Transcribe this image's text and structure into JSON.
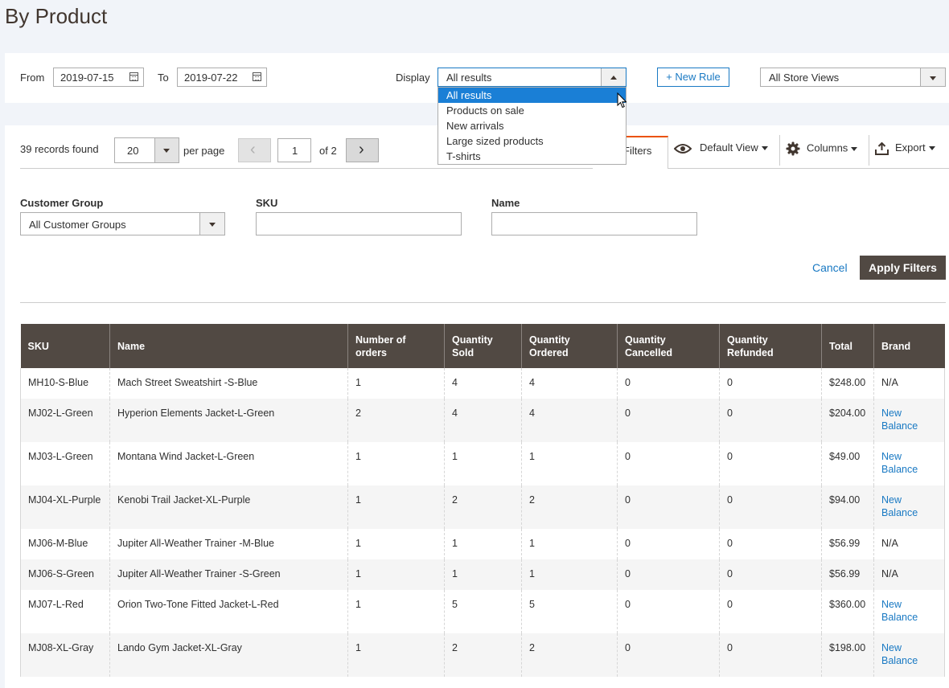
{
  "page": {
    "title": "By Product"
  },
  "topbar": {
    "from_label": "From",
    "from_value": "2019-07-15",
    "to_label": "To",
    "to_value": "2019-07-22",
    "display_label": "Display",
    "display_value": "All results",
    "display_options": [
      "All results",
      "Products on sale",
      "New arrivals",
      "Large sized products",
      "T-shirts"
    ],
    "new_rule_label": "+ New Rule",
    "store_view_value": "All Store Views"
  },
  "grid_toolbar": {
    "records_text": "39 records found",
    "per_page_value": "20",
    "per_page_label": "per page",
    "page_value": "1",
    "page_of": "of 2",
    "filters_tab": "Filters",
    "default_view": "Default View",
    "columns": "Columns",
    "export": "Export"
  },
  "filters": {
    "customer_group_label": "Customer Group",
    "customer_group_value": "All Customer Groups",
    "sku_label": "SKU",
    "name_label": "Name",
    "cancel_label": "Cancel",
    "apply_label": "Apply Filters"
  },
  "table": {
    "headers": [
      "SKU",
      "Name",
      "Number of orders",
      "Quantity Sold",
      "Quantity Ordered",
      "Quantity Cancelled",
      "Quantity Refunded",
      "Total",
      "Brand"
    ],
    "rows": [
      {
        "sku": "MH10-S-Blue",
        "name": "Mach Street Sweatshirt -S-Blue",
        "orders": "1",
        "sold": "4",
        "ordered": "4",
        "cancelled": "0",
        "refunded": "0",
        "total": "$248.00",
        "brand": "N/A"
      },
      {
        "sku": "MJ02-L-Green",
        "name": "Hyperion Elements Jacket-L-Green",
        "orders": "2",
        "sold": "4",
        "ordered": "4",
        "cancelled": "0",
        "refunded": "0",
        "total": "$204.00",
        "brand": "New Balance"
      },
      {
        "sku": "MJ03-L-Green",
        "name": "Montana Wind Jacket-L-Green",
        "orders": "1",
        "sold": "1",
        "ordered": "1",
        "cancelled": "0",
        "refunded": "0",
        "total": "$49.00",
        "brand": "New Balance"
      },
      {
        "sku": "MJ04-XL-Purple",
        "name": "Kenobi Trail Jacket-XL-Purple",
        "orders": "1",
        "sold": "2",
        "ordered": "2",
        "cancelled": "0",
        "refunded": "0",
        "total": "$94.00",
        "brand": "New Balance"
      },
      {
        "sku": "MJ06-M-Blue",
        "name": "Jupiter All-Weather Trainer -M-Blue",
        "orders": "1",
        "sold": "1",
        "ordered": "1",
        "cancelled": "0",
        "refunded": "0",
        "total": "$56.99",
        "brand": "N/A"
      },
      {
        "sku": "MJ06-S-Green",
        "name": "Jupiter All-Weather Trainer -S-Green",
        "orders": "1",
        "sold": "1",
        "ordered": "1",
        "cancelled": "0",
        "refunded": "0",
        "total": "$56.99",
        "brand": "N/A"
      },
      {
        "sku": "MJ07-L-Red",
        "name": "Orion Two-Tone Fitted Jacket-L-Red",
        "orders": "1",
        "sold": "5",
        "ordered": "5",
        "cancelled": "0",
        "refunded": "0",
        "total": "$360.00",
        "brand": "New Balance"
      },
      {
        "sku": "MJ08-XL-Gray",
        "name": "Lando Gym Jacket-XL-Gray",
        "orders": "1",
        "sold": "2",
        "ordered": "2",
        "cancelled": "0",
        "refunded": "0",
        "total": "$198.00",
        "brand": "New Balance"
      }
    ]
  },
  "colors": {
    "header_bg": "#514943",
    "link": "#1979c3",
    "selected_option": "#1a7fd6",
    "tab_accent": "#eb5202"
  }
}
